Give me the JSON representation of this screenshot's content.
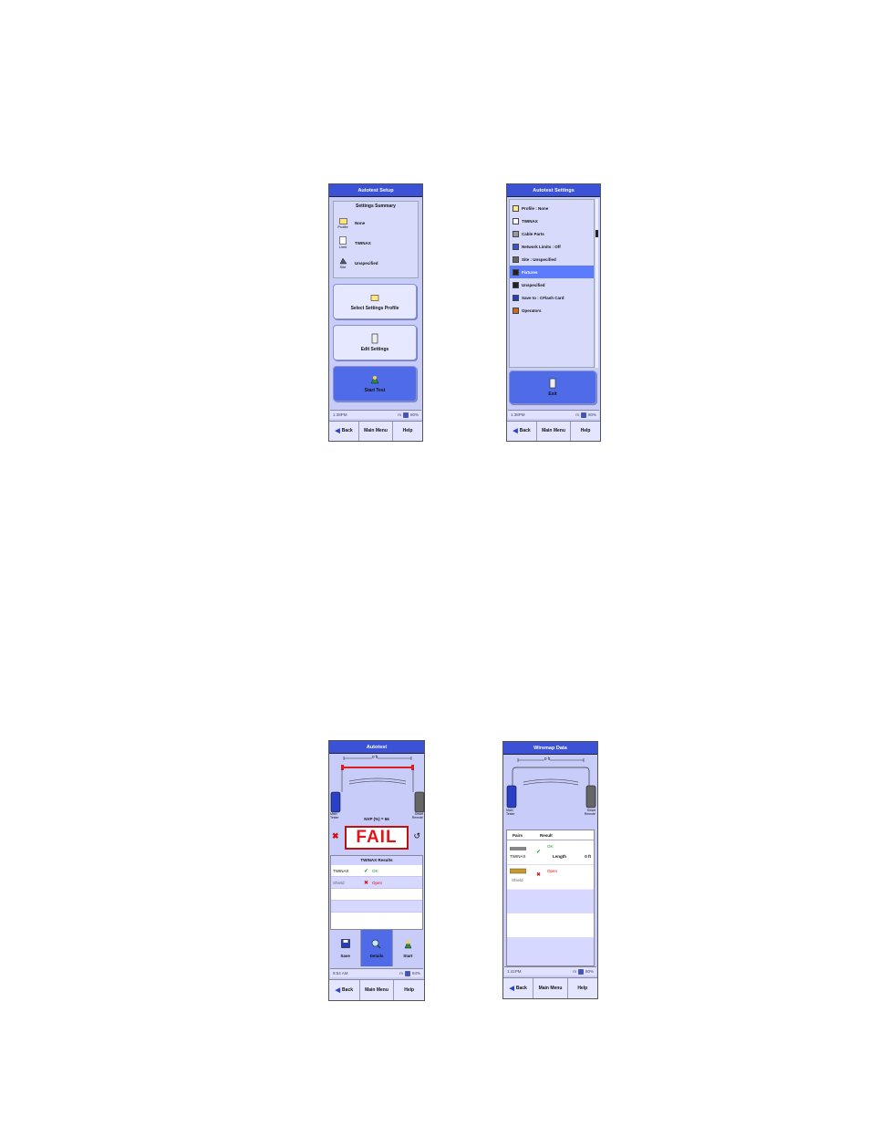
{
  "screen1": {
    "title": "Autotest Setup",
    "summary_header": "Settings Summary",
    "summary_rows": [
      {
        "label": "Profile",
        "value": "None",
        "icon": "folder-icon"
      },
      {
        "label": "Limit",
        "value": "TWINAX",
        "icon": "document-icon"
      },
      {
        "label": "Site",
        "value": "Unspecified",
        "icon": "site-icon"
      }
    ],
    "select_profile_label": "Select Settings Profile",
    "edit_settings_label": "Edit Settings",
    "start_test_label": "Start Test",
    "status_time": "1:38PM",
    "status_units": "m",
    "status_battery": "80%"
  },
  "screen2": {
    "title": "Autotest Settings",
    "items": [
      {
        "label": "Profile : None",
        "icon": "folder-icon"
      },
      {
        "label": "TWINAX",
        "icon": "document-icon"
      },
      {
        "label": "Cable Parts",
        "icon": "cable-icon"
      },
      {
        "label": "Network Limits : Off",
        "icon": "network-icon"
      },
      {
        "label": "Site : Unspecified",
        "icon": "site-icon"
      },
      {
        "label": "Fixtures",
        "icon": "fixture-icon"
      },
      {
        "label": "Unspecified",
        "icon": "camera-icon"
      },
      {
        "label": "Save to : CFlash Card",
        "icon": "save-icon"
      },
      {
        "label": "Operators",
        "icon": "operator-icon"
      }
    ],
    "selected_index": 5,
    "exit_label": "Exit",
    "status_time": "1:38PM",
    "status_units": "m",
    "status_battery": "80%"
  },
  "screen3": {
    "title": "Autotest",
    "length_label": "0 ft",
    "near_label": "Main Tester",
    "far_label": "Smart Remote",
    "nvp_label": "NVP (%) = 66",
    "verdict": "FAIL",
    "results_header": "TWINAX Results",
    "results": [
      {
        "name": "TWINAX",
        "status": "OK",
        "pass": true
      },
      {
        "name": "Shield",
        "status": "Open",
        "pass": false
      }
    ],
    "save_label": "Save",
    "details_label": "Details",
    "start_label": "Start",
    "status_time": "9:54 AM",
    "status_units": "m",
    "status_battery": "84%"
  },
  "screen4": {
    "title": "Wiremap Data",
    "length_label": "0 ft",
    "near_label": "Main Tester",
    "far_label": "Smart Remote",
    "col_pairs": "Pairs",
    "col_result": "Result",
    "rows": [
      {
        "name": "TWINAX",
        "status": "OK",
        "pass": true,
        "extra_label": "Length",
        "extra_value": "0 ft"
      },
      {
        "name": "Shield",
        "status": "Open",
        "pass": false
      }
    ],
    "status_time": "1:41PM",
    "status_units": "m",
    "status_battery": "80%"
  },
  "nav": {
    "back": "Back",
    "main_menu": "Main Menu",
    "help": "Help"
  },
  "colors": {
    "title_blue": "#3b52d6",
    "screen_bg": "#c8ccf8",
    "fail_red": "#e0151b",
    "ok_green": "#1a9a2a"
  }
}
